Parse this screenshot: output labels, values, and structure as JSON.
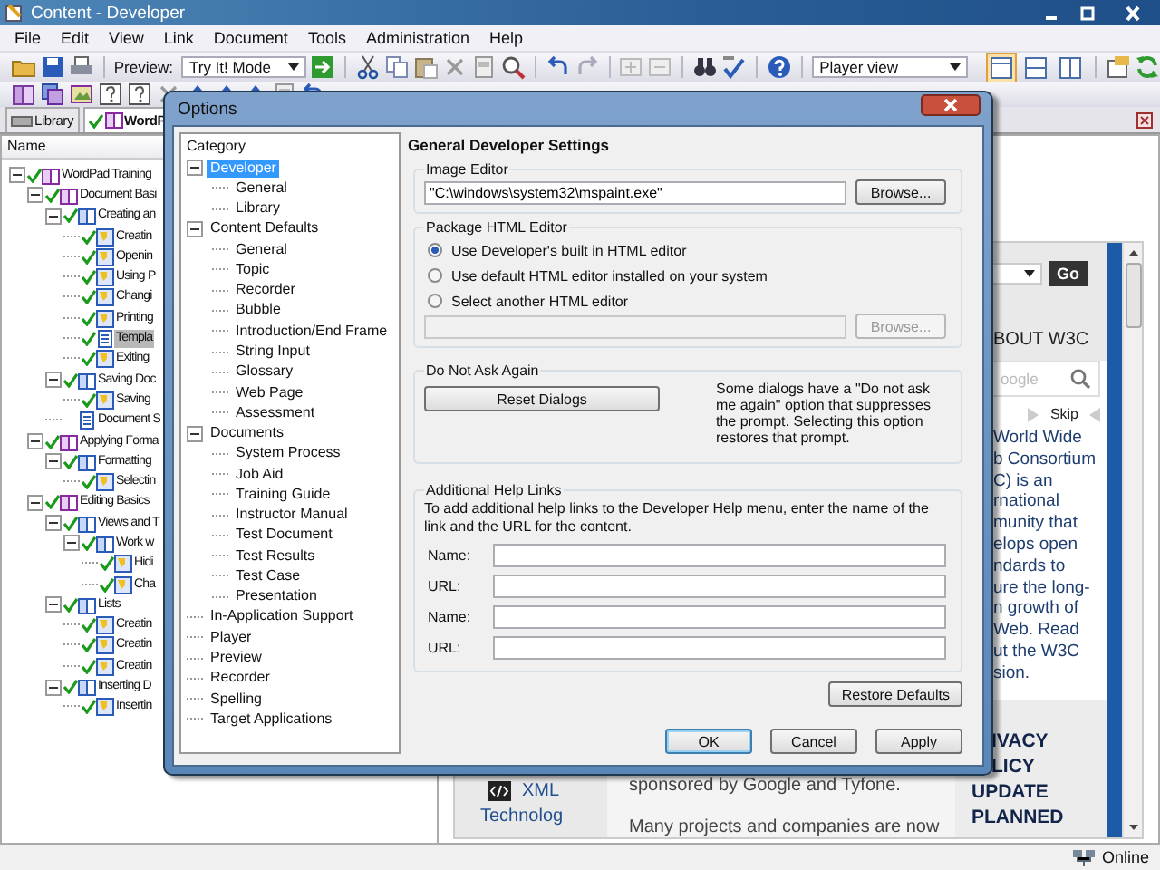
{
  "window": {
    "title": "Content - Developer"
  },
  "menu": [
    "File",
    "Edit",
    "View",
    "Link",
    "Document",
    "Tools",
    "Administration",
    "Help"
  ],
  "toolbar": {
    "preview_label": "Preview:",
    "preview_mode": "Try It! Mode",
    "view_mode": "Player view",
    "layout_buttons": [
      {
        "selected": true
      },
      {
        "selected": false
      },
      {
        "selected": false
      }
    ]
  },
  "tabs": [
    {
      "label": "Library",
      "selected": false
    },
    {
      "label": "WordP",
      "selected": true
    }
  ],
  "outline": {
    "header": "Name",
    "items": [
      {
        "label": "WordPad Training",
        "kind": "module",
        "checked": true,
        "selected": false,
        "children": [
          {
            "label": "Document Basi",
            "kind": "module",
            "checked": true,
            "selected": false,
            "children": [
              {
                "label": "Creating an",
                "kind": "section",
                "checked": true,
                "selected": false,
                "children": [
                  {
                    "label": "Creatin",
                    "kind": "topic",
                    "checked": true,
                    "selected": false
                  },
                  {
                    "label": "Openin",
                    "kind": "topic",
                    "checked": true,
                    "selected": false
                  },
                  {
                    "label": "Using P",
                    "kind": "topic",
                    "checked": true,
                    "selected": false
                  },
                  {
                    "label": "Changi",
                    "kind": "topic",
                    "checked": true,
                    "selected": false
                  },
                  {
                    "label": "Printing",
                    "kind": "topic",
                    "checked": true,
                    "selected": false
                  },
                  {
                    "label": "Templa",
                    "kind": "document",
                    "checked": true,
                    "selected": true
                  },
                  {
                    "label": "Exiting",
                    "kind": "topic",
                    "checked": true,
                    "selected": false
                  }
                ]
              },
              {
                "label": "Saving Doc",
                "kind": "section",
                "checked": true,
                "selected": false,
                "children": [
                  {
                    "label": "Saving",
                    "kind": "topic",
                    "checked": true,
                    "selected": false
                  }
                ]
              },
              {
                "label": "Document S",
                "kind": "document",
                "checked": false,
                "selected": false
              }
            ]
          },
          {
            "label": "Applying Forma",
            "kind": "module",
            "checked": true,
            "selected": false,
            "children": [
              {
                "label": "Formatting",
                "kind": "section",
                "checked": true,
                "selected": false,
                "children": [
                  {
                    "label": "Selectin",
                    "kind": "topic",
                    "checked": true,
                    "selected": false
                  }
                ]
              }
            ]
          },
          {
            "label": "Editing Basics",
            "kind": "module",
            "checked": true,
            "selected": false,
            "children": [
              {
                "label": "Views and T",
                "kind": "section",
                "checked": true,
                "selected": false,
                "children": [
                  {
                    "label": "Work w",
                    "kind": "section",
                    "checked": true,
                    "selected": false,
                    "children": [
                      {
                        "label": "Hidi",
                        "kind": "topic",
                        "checked": true,
                        "selected": false
                      },
                      {
                        "label": "Cha",
                        "kind": "topic",
                        "checked": true,
                        "selected": false
                      }
                    ]
                  }
                ]
              },
              {
                "label": "Lists",
                "kind": "section",
                "checked": true,
                "selected": false,
                "children": [
                  {
                    "label": "Creatin",
                    "kind": "topic",
                    "checked": true,
                    "selected": false
                  },
                  {
                    "label": "Creatin",
                    "kind": "topic",
                    "checked": true,
                    "selected": false
                  },
                  {
                    "label": "Creatin",
                    "kind": "topic",
                    "checked": true,
                    "selected": false
                  }
                ]
              },
              {
                "label": "Inserting D",
                "kind": "section",
                "checked": true,
                "selected": false,
                "children": [
                  {
                    "label": "Insertin",
                    "kind": "topic",
                    "checked": true,
                    "selected": false
                  }
                ]
              }
            ]
          }
        ]
      }
    ]
  },
  "web_page": {
    "go_button": "Go",
    "about_heading": "BOUT W3C",
    "search_placeholder": "oogle",
    "skip": "Skip",
    "about_lines": [
      "World Wide",
      "b Consortium",
      "C) is an",
      "rnational",
      "munity that",
      "elops open",
      "ndards to",
      "ure the long-",
      "n growth of",
      "Web. Read",
      "ut the W3C",
      "sion."
    ],
    "news_lines": [
      "IVACY",
      "LICY",
      "UPDATE",
      "PLANNED"
    ],
    "sidebar_link": [
      "XML",
      "Technolog"
    ],
    "body_lines": [
      "sponsored by Google and Tyfone.",
      "Many projects and companies are now"
    ]
  },
  "status_bar": {
    "status": "Online"
  },
  "dialog": {
    "title": "Options",
    "category_header": "Category",
    "categories": [
      {
        "label": "Developer",
        "selected": true,
        "children": [
          {
            "label": "General",
            "selected": false
          },
          {
            "label": "Library",
            "selected": false
          }
        ]
      },
      {
        "label": "Content Defaults",
        "selected": false,
        "children": [
          {
            "label": "General",
            "selected": false
          },
          {
            "label": "Topic",
            "selected": false
          },
          {
            "label": "Recorder",
            "selected": false
          },
          {
            "label": "Bubble",
            "selected": false
          },
          {
            "label": "Introduction/End Frame",
            "selected": false
          },
          {
            "label": "String Input",
            "selected": false
          },
          {
            "label": "Glossary",
            "selected": false
          },
          {
            "label": "Web Page",
            "selected": false
          },
          {
            "label": "Assessment",
            "selected": false
          }
        ]
      },
      {
        "label": "Documents",
        "selected": false,
        "children": [
          {
            "label": "System Process",
            "selected": false
          },
          {
            "label": "Job Aid",
            "selected": false
          },
          {
            "label": "Training Guide",
            "selected": false
          },
          {
            "label": "Instructor Manual",
            "selected": false
          },
          {
            "label": "Test Document",
            "selected": false
          },
          {
            "label": "Test Results",
            "selected": false
          },
          {
            "label": "Test Case",
            "selected": false
          },
          {
            "label": "Presentation",
            "selected": false
          }
        ]
      },
      {
        "label": "In-Application Support",
        "selected": false
      },
      {
        "label": "Player",
        "selected": false
      },
      {
        "label": "Preview",
        "selected": false
      },
      {
        "label": "Recorder",
        "selected": false
      },
      {
        "label": "Spelling",
        "selected": false
      },
      {
        "label": "Target Applications",
        "selected": false
      }
    ],
    "heading": "General Developer Settings",
    "image_editor": {
      "legend": "Image Editor",
      "value": "\"C:\\windows\\system32\\mspaint.exe\"",
      "button": "Browse..."
    },
    "html_editor": {
      "legend": "Package HTML Editor",
      "options": [
        {
          "label": "Use Developer's built in HTML editor",
          "selected": true
        },
        {
          "label": "Use default HTML editor installed on your system",
          "selected": false
        },
        {
          "label": "Select another HTML editor",
          "selected": false
        }
      ],
      "button": "Browse...",
      "disabled": true
    },
    "do_not_ask": {
      "legend": "Do Not Ask Again",
      "button": "Reset Dialogs",
      "note": "Some dialogs have a \"Do not ask me again\" option that suppresses the prompt. Selecting this option restores that prompt."
    },
    "help_links": {
      "legend": "Additional Help Links",
      "description": "To add additional help links to the Developer Help menu, enter the name of the link and the URL for the content.",
      "fields": [
        {
          "label": "Name:"
        },
        {
          "label": "URL:"
        },
        {
          "label": "Name:"
        },
        {
          "label": "URL:"
        }
      ]
    },
    "restore_button": "Restore Defaults",
    "buttons": [
      {
        "label": "OK",
        "default": true
      },
      {
        "label": "Cancel",
        "default": false
      },
      {
        "label": "Apply",
        "default": false
      }
    ]
  }
}
